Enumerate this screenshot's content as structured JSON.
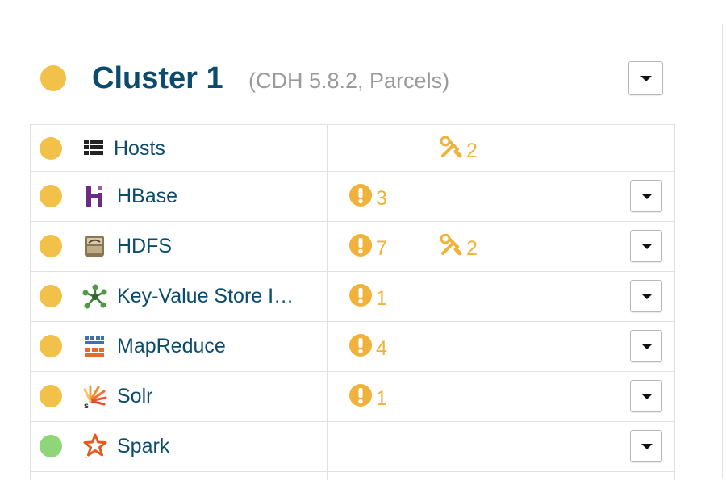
{
  "cluster": {
    "title": "Cluster 1",
    "subtitle": "(CDH 5.8.2, Parcels)",
    "status_color": "#f1c14a"
  },
  "colors": {
    "link": "#0b4c6e",
    "warning": "#f0b23a",
    "status_yellow": "#f1c14a",
    "status_green": "#8fd679"
  },
  "rows": [
    {
      "name": "Hosts",
      "status": "warning",
      "icon": "hosts-list-icon",
      "alerts": null,
      "config_issues": "2",
      "has_menu": false
    },
    {
      "name": "HBase",
      "status": "warning",
      "icon": "hbase-icon",
      "alerts": "3",
      "config_issues": null,
      "has_menu": true
    },
    {
      "name": "HDFS",
      "status": "warning",
      "icon": "hdfs-icon",
      "alerts": "7",
      "config_issues": "2",
      "has_menu": true
    },
    {
      "name": "Key-Value Store I…",
      "status": "warning",
      "icon": "key-value-store-icon",
      "alerts": "1",
      "config_issues": null,
      "has_menu": true
    },
    {
      "name": "MapReduce",
      "status": "warning",
      "icon": "mapreduce-icon",
      "alerts": "4",
      "config_issues": null,
      "has_menu": true
    },
    {
      "name": "Solr",
      "status": "warning",
      "icon": "solr-icon",
      "alerts": "1",
      "config_issues": null,
      "has_menu": true
    },
    {
      "name": "Spark",
      "status": "good",
      "icon": "spark-icon",
      "alerts": null,
      "config_issues": null,
      "has_menu": true
    }
  ]
}
